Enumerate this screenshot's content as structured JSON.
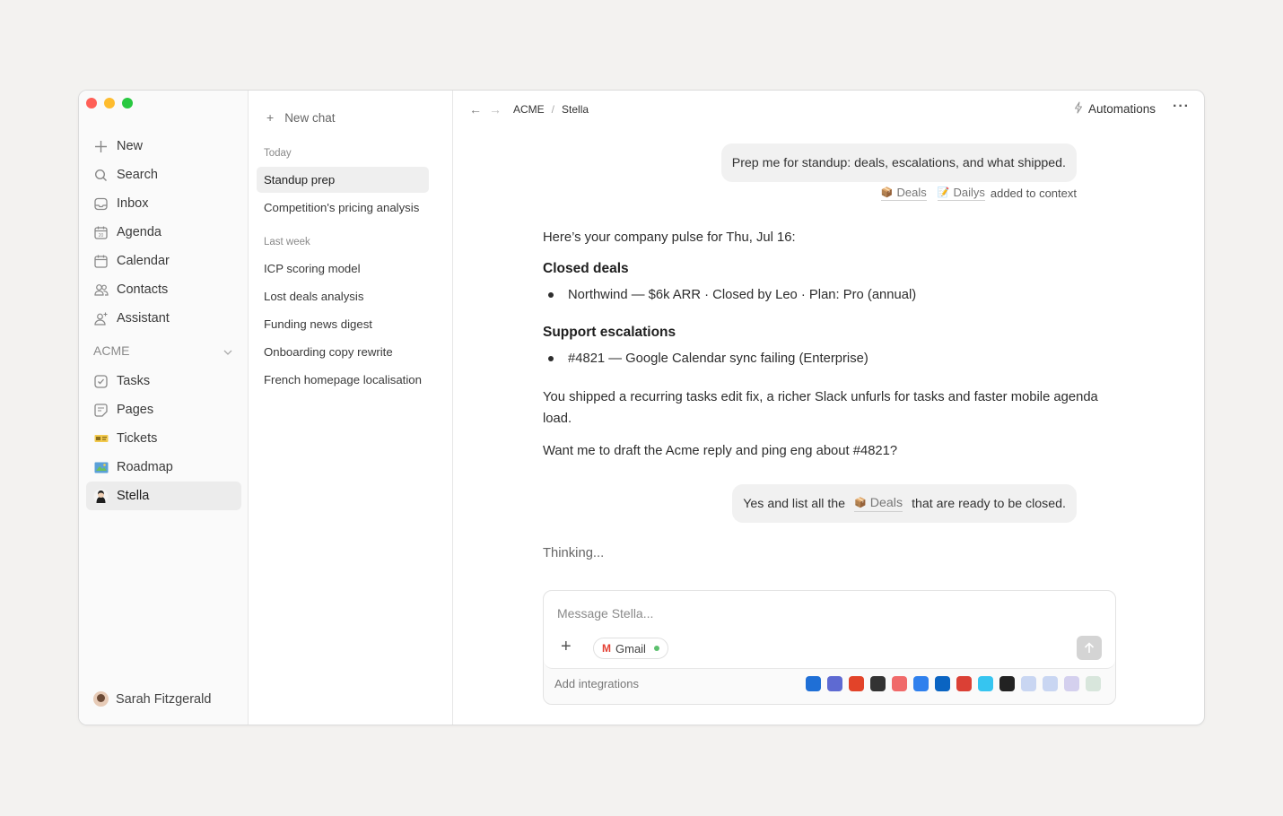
{
  "sidebar": {
    "items": [
      {
        "label": "New",
        "icon": "plus-icon"
      },
      {
        "label": "Search",
        "icon": "search-icon"
      },
      {
        "label": "Inbox",
        "icon": "inbox-icon"
      },
      {
        "label": "Agenda",
        "icon": "agenda-calendar-icon"
      },
      {
        "label": "Calendar",
        "icon": "calendar-icon"
      },
      {
        "label": "Contacts",
        "icon": "contacts-icon"
      },
      {
        "label": "Assistant",
        "icon": "assistant-sparkle-icon"
      }
    ],
    "workspace": "ACME",
    "workspace_items": [
      {
        "label": "Tasks",
        "icon": "check-square-icon"
      },
      {
        "label": "Pages",
        "icon": "page-icon"
      },
      {
        "label": "Tickets",
        "icon": "ticket-emoji-icon"
      },
      {
        "label": "Roadmap",
        "icon": "map-emoji-icon"
      },
      {
        "label": "Stella",
        "icon": "stella-avatar-icon"
      }
    ],
    "user": "Sarah Fitzgerald"
  },
  "chats": {
    "new_chat": "New chat",
    "today_label": "Today",
    "today": [
      "Standup prep",
      "Competition's pricing analysis"
    ],
    "last_week_label": "Last week",
    "last_week": [
      "ICP scoring model",
      "Lost deals analysis",
      "Funding news digest",
      "Onboarding copy rewrite",
      "French homepage localisation"
    ]
  },
  "header": {
    "breadcrumb": [
      "ACME",
      "Stella"
    ],
    "automations": "Automations",
    "more": "···"
  },
  "conversation": {
    "user_msg_1": "Prep me for standup: deals, escalations, and what shipped.",
    "context_chips": [
      "Deals",
      "Dailys"
    ],
    "context_suffix": "added to context",
    "intro": "Here’s your company pulse for Thu, Jul 16:",
    "closed_deals_heading": "Closed deals",
    "closed_deals": [
      "Northwind — $6k ARR · Closed by Leo · Plan: Pro (annual)"
    ],
    "support_heading": "Support escalations",
    "support": [
      "#4821 — Google Calendar sync failing (Enterprise)"
    ],
    "shipped": "You shipped a recurring tasks edit fix, a richer Slack unfurls for tasks and faster mobile agenda load.",
    "question": "Want me to draft the Acme reply and ping eng about #4821?",
    "user_msg_2_pre": "Yes and list all the",
    "user_msg_2_chip": "Deals",
    "user_msg_2_post": "that are ready to be closed.",
    "thinking": "Thinking..."
  },
  "composer": {
    "placeholder": "Message Stella...",
    "gmail": "Gmail",
    "add_integrations": "Add integrations",
    "integrations": [
      {
        "name": "trello-icon",
        "color": "#1f6fd6"
      },
      {
        "name": "linear-icon",
        "color": "#5e6ad2"
      },
      {
        "name": "gitlab-icon",
        "color": "#e24329"
      },
      {
        "name": "zapier-icon",
        "color": "#333333"
      },
      {
        "name": "asana-icon",
        "color": "#f06a6a"
      },
      {
        "name": "todoist-check-icon",
        "color": "#2f80ed"
      },
      {
        "name": "outlook-icon",
        "color": "#0a64c2"
      },
      {
        "name": "todoist-icon",
        "color": "#db4035"
      },
      {
        "name": "slack-icon",
        "color": "#36c5f0"
      },
      {
        "name": "github-icon",
        "color": "#222222"
      },
      {
        "name": "integration-faded-1-icon",
        "color": "#c9d6f2"
      },
      {
        "name": "integration-faded-2-icon",
        "color": "#c9d6f2"
      },
      {
        "name": "integration-faded-3-icon",
        "color": "#d4d0ee"
      },
      {
        "name": "whatsapp-faded-icon",
        "color": "#d8e6dc"
      }
    ]
  }
}
